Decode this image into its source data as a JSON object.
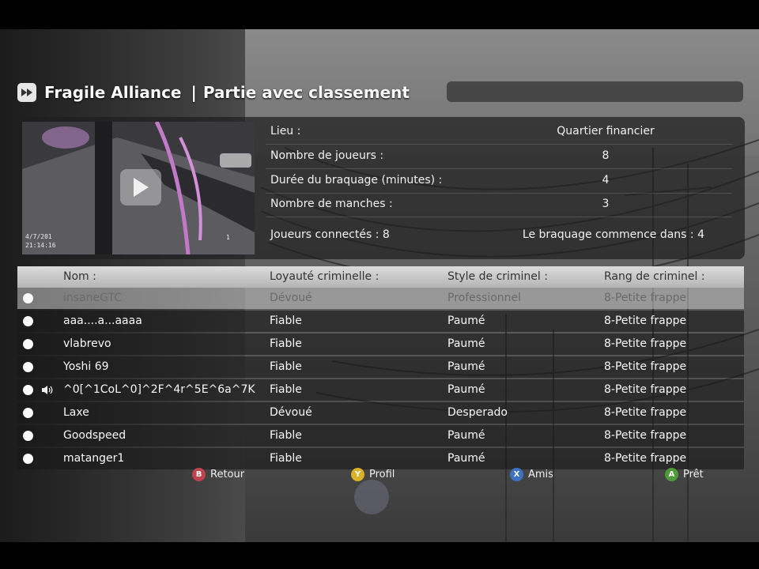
{
  "header": {
    "game_title": "Fragile Alliance",
    "mode": "Partie avec classement",
    "separator": "|"
  },
  "video": {
    "timestamp_date": "4/7/201",
    "timestamp_time": "21:14:16",
    "camera_label": "1"
  },
  "match_info": {
    "rows": [
      {
        "label": "Lieu :",
        "value": "Quartier financier"
      },
      {
        "label": "Nombre de joueurs :",
        "value": "8"
      },
      {
        "label": "Durée du braquage (minutes) :",
        "value": "4"
      },
      {
        "label": "Nombre de manches :",
        "value": "3"
      }
    ],
    "connected": "Joueurs connectés : 8",
    "starts_in": "Le braquage commence dans : 4"
  },
  "table": {
    "columns": [
      "Nom :",
      "Loyauté criminelle :",
      "Style de criminel :",
      "Rang de criminel :"
    ],
    "players": [
      {
        "name": "insaneGTC",
        "loyalty": "Dévoué",
        "style": "Professionnel",
        "rank": "8-Petite frappe",
        "selected": true
      },
      {
        "name": "aaa....a...aaaa",
        "loyalty": "Fiable",
        "style": "Paumé",
        "rank": "8-Petite frappe"
      },
      {
        "name": "vlabrevo",
        "loyalty": "Fiable",
        "style": "Paumé",
        "rank": "8-Petite frappe"
      },
      {
        "name": "Yoshi 69",
        "loyalty": "Fiable",
        "style": "Paumé",
        "rank": "8-Petite frappe"
      },
      {
        "name": "^0[^1CoL^0]^2F^4r^5E^6a^7K",
        "loyalty": "Fiable",
        "style": "Paumé",
        "rank": "8-Petite frappe",
        "talking": true
      },
      {
        "name": "Laxe",
        "loyalty": "Dévoué",
        "style": "Desperado",
        "rank": "8-Petite frappe"
      },
      {
        "name": "Goodspeed",
        "loyalty": "Fiable",
        "style": "Paumé",
        "rank": "8-Petite frappe"
      },
      {
        "name": "matanger1",
        "loyalty": "Fiable",
        "style": "Paumé",
        "rank": "8-Petite frappe"
      }
    ]
  },
  "footer": {
    "back": {
      "key": "B",
      "label": "Retour",
      "color": "#c0434f"
    },
    "profile": {
      "key": "Y",
      "label": "Profil",
      "color": "#d9b227"
    },
    "friends": {
      "key": "X",
      "label": "Amis",
      "color": "#3d72c4"
    },
    "ready": {
      "key": "A",
      "label": "Prêt",
      "color": "#4f9b3a"
    }
  }
}
